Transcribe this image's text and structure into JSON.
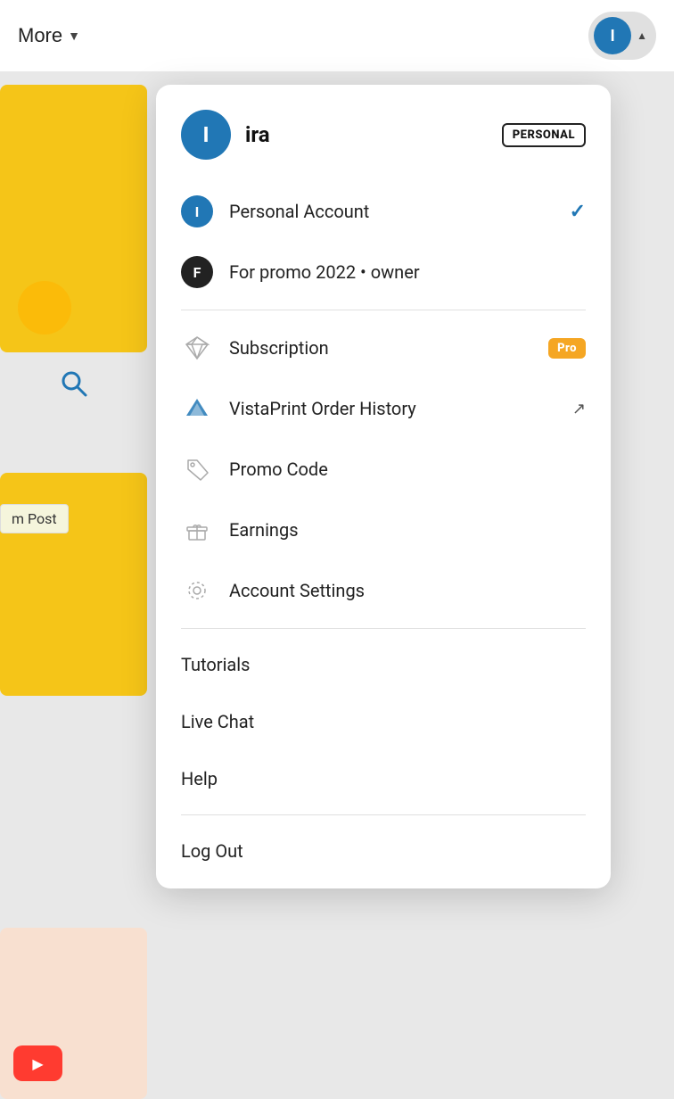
{
  "topbar": {
    "more_label": "More",
    "user_initial": "I",
    "user_caret": "▲"
  },
  "dropdown": {
    "user_initial": "I",
    "user_name": "ira",
    "personal_badge": "PERSONAL",
    "items": [
      {
        "id": "personal-account",
        "icon_type": "avatar-blue",
        "icon_label": "I",
        "label": "Personal Account",
        "suffix": "check"
      },
      {
        "id": "for-promo",
        "icon_type": "avatar-black",
        "icon_label": "F",
        "label": "For promo 2022 • owner",
        "suffix": ""
      }
    ],
    "subscription_label": "Subscription",
    "subscription_badge": "Pro",
    "vistaprint_label": "VistaPrint Order History",
    "promo_code_label": "Promo Code",
    "earnings_label": "Earnings",
    "account_settings_label": "Account Settings",
    "tutorials_label": "Tutorials",
    "live_chat_label": "Live Chat",
    "help_label": "Help",
    "log_out_label": "Log Out"
  },
  "background": {
    "m_post_label": "m Post"
  }
}
